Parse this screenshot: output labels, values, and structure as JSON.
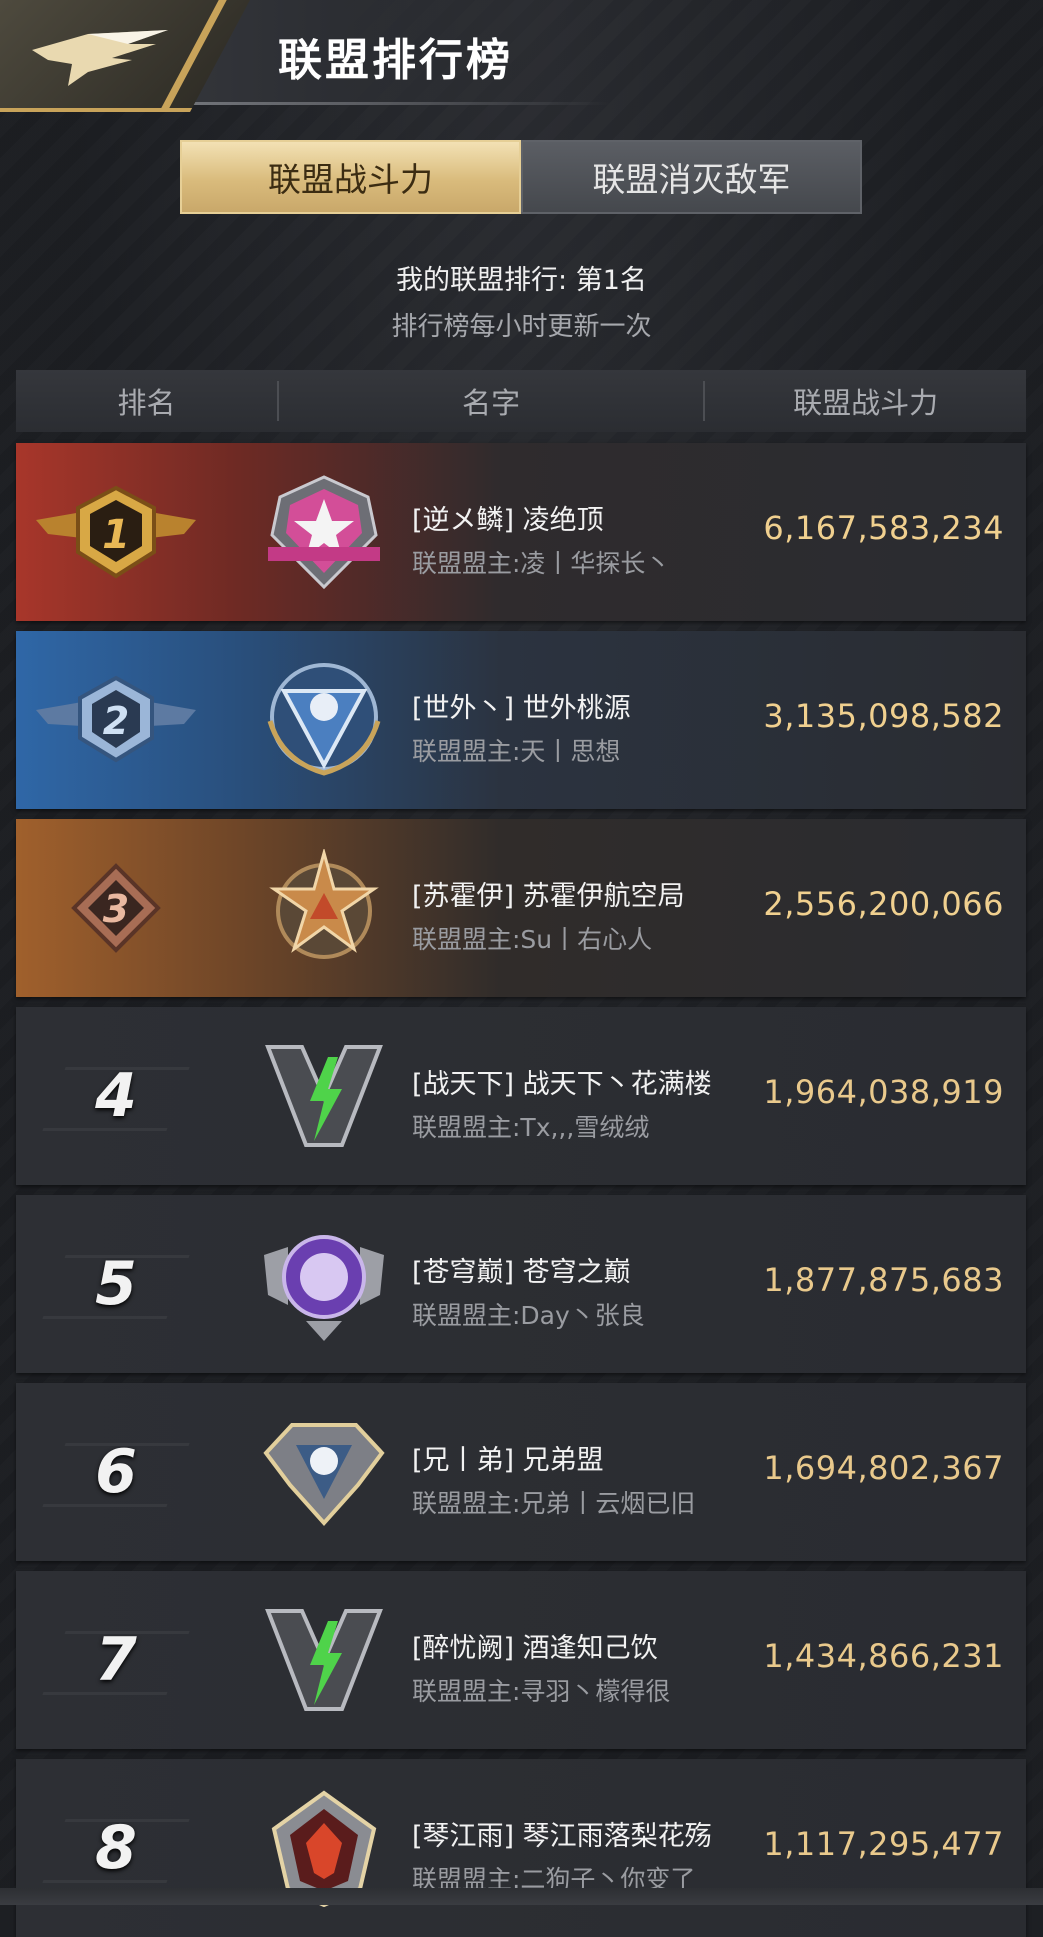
{
  "header": {
    "title": "联盟排行榜",
    "logo_icon": "eagle-wings-icon",
    "accent": "#c8a35a"
  },
  "tabs": [
    {
      "label": "联盟战斗力",
      "active": true
    },
    {
      "label": "联盟消灭敌军",
      "active": false
    }
  ],
  "info": {
    "my_rank": "我的联盟排行: 第1名",
    "update_note": "排行榜每小时更新一次"
  },
  "table": {
    "columns": [
      "排名",
      "名字",
      "联盟战斗力"
    ]
  },
  "rows": [
    {
      "rank": "1",
      "emblem": "pink-star-emblem-icon",
      "name": "[逆メ鳞] 凌绝顶",
      "leader": "联盟盟主:凌丨华探长丶",
      "power": "6,167,583,234",
      "rank_color": "#c8953a"
    },
    {
      "rank": "2",
      "emblem": "blue-eagle-shield-emblem-icon",
      "name": "[世外丶] 世外桃源",
      "leader": "联盟盟主:天丨思想",
      "power": "3,135,098,582",
      "rank_color": "#8fa6c2"
    },
    {
      "rank": "3",
      "emblem": "bronze-star-emblem-icon",
      "name": "[苏霍伊] 苏霍伊航空局",
      "leader": "联盟盟主:Su丨右心人",
      "power": "2,556,200,066",
      "rank_color": "#c98a6a"
    },
    {
      "rank": "4",
      "emblem": "green-lightning-emblem-icon",
      "name": "[战天下] 战天下丶花满楼",
      "leader": "联盟盟主:Tx,,,雪绒绒",
      "power": "1,964,038,919"
    },
    {
      "rank": "5",
      "emblem": "purple-tiger-emblem-icon",
      "name": "[苍穹巅] 苍穹之巅",
      "leader": "联盟盟主:Day丶张良",
      "power": "1,877,875,683"
    },
    {
      "rank": "6",
      "emblem": "silver-wolf-emblem-icon",
      "name": "[兄丨弟] 兄弟盟",
      "leader": "联盟盟主:兄弟丨云烟已旧",
      "power": "1,694,802,367"
    },
    {
      "rank": "7",
      "emblem": "green-lightning-emblem-icon",
      "name": "[醉忧阙] 酒逢知己饮",
      "leader": "联盟盟主:寻羽丶檬得很",
      "power": "1,434,866,231"
    },
    {
      "rank": "8",
      "emblem": "red-wolf-emblem-icon",
      "name": "[琴江雨] 琴江雨落梨花殇",
      "leader": "联盟盟主:二狗子丶你变了",
      "power": "1,117,295,477"
    }
  ]
}
